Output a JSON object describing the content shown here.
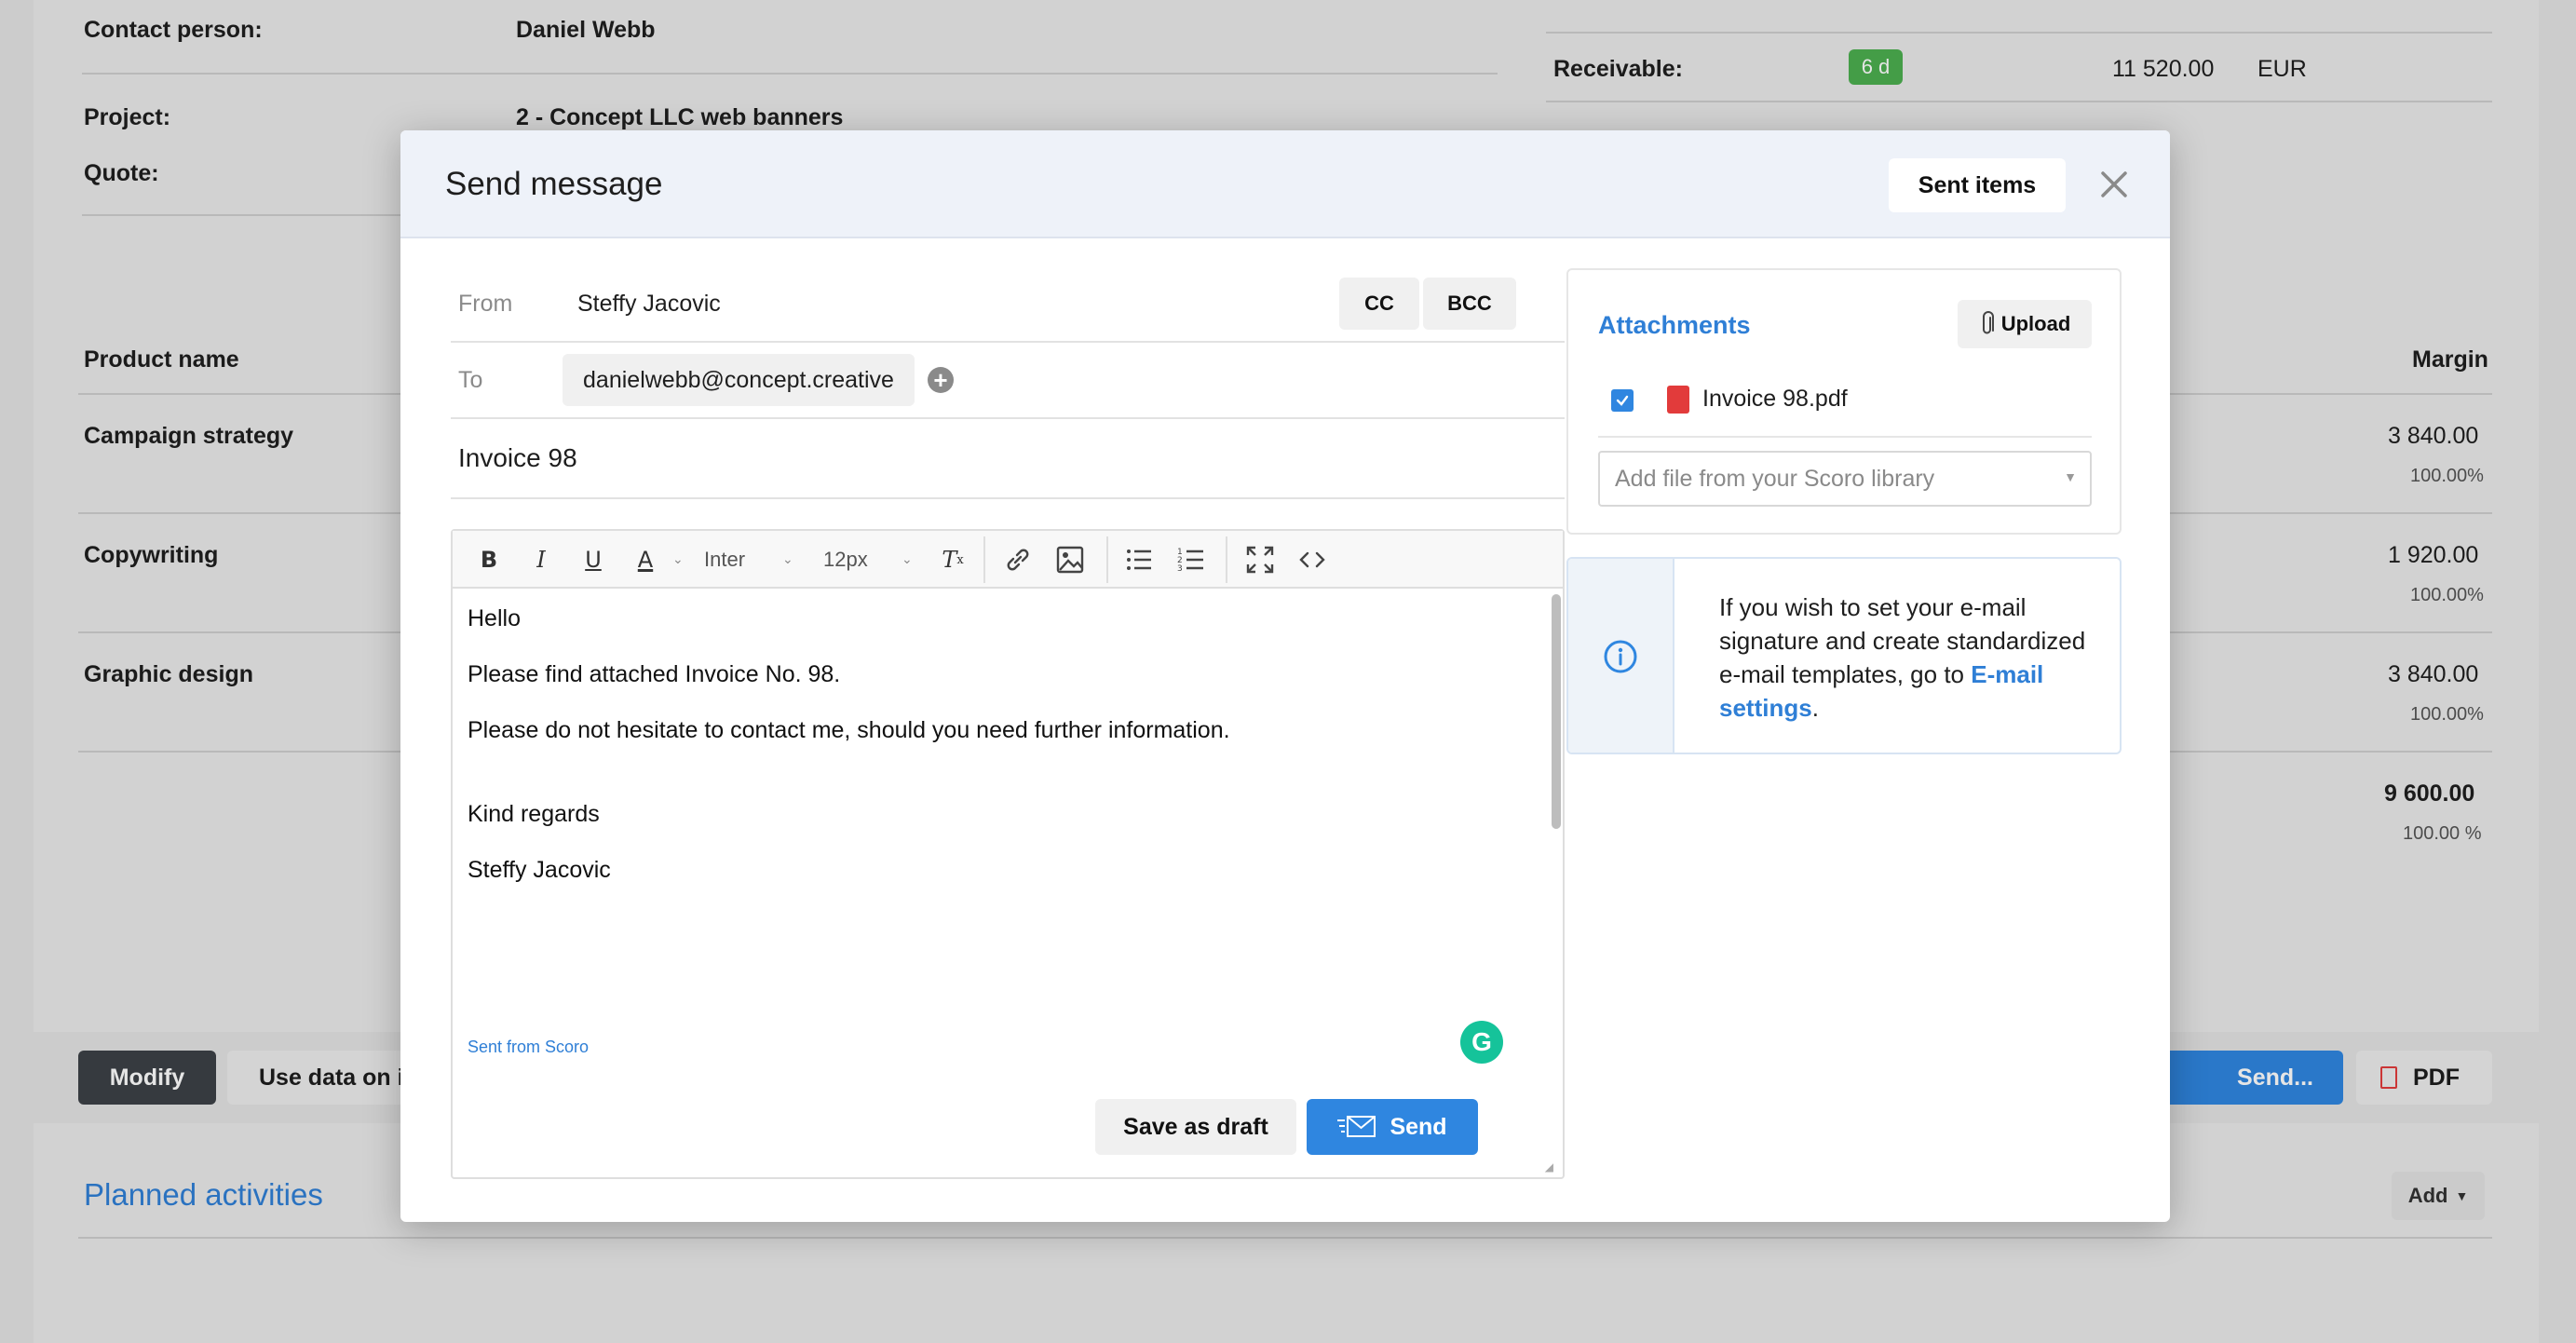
{
  "background": {
    "contact_label": "Contact person:",
    "contact_value": "Daniel Webb",
    "project_label": "Project:",
    "project_value": "2 - Concept LLC web banners",
    "quote_label": "Quote:",
    "receivable_label": "Receivable:",
    "receivable_badge": "6 d",
    "receivable_amount": "11 520.00",
    "receivable_currency": "EUR",
    "product_name_header": "Product name",
    "margin_header": "Margin",
    "products": [
      {
        "name": "Campaign strategy",
        "margin": "3 840.00",
        "pct": "100.00%"
      },
      {
        "name": "Copywriting",
        "margin": "1 920.00",
        "pct": "100.00%"
      },
      {
        "name": "Graphic design",
        "margin": "3 840.00",
        "pct": "100.00%"
      }
    ],
    "total_margin": "9 600.00",
    "total_pct": "100.00 %",
    "modify_button": "Modify",
    "use_data_button": "Use data on i",
    "send_button": "Send...",
    "pdf_button": "PDF",
    "planned_activities": "Planned activities",
    "add_button": "Add"
  },
  "modal": {
    "title": "Send message",
    "sent_items_button": "Sent items",
    "from_label": "From",
    "from_value": "Steffy Jacovic",
    "cc_button": "CC",
    "bcc_button": "BCC",
    "to_label": "To",
    "to_value": "danielwebb@concept.creative",
    "subject": "Invoice 98",
    "toolbar": {
      "font_family": "Inter",
      "font_size": "12px"
    },
    "body": {
      "line1": "Hello",
      "line2": "Please find attached Invoice No. 98.",
      "line3": "Please do not hesitate to contact me, should you need further information.",
      "line4": "Kind regards",
      "line5": "Steffy Jacovic",
      "signature": "Sent from Scoro"
    },
    "save_draft_button": "Save as draft",
    "send_button": "Send",
    "attachments": {
      "title": "Attachments",
      "upload_button": "Upload",
      "file_name": "Invoice 98.pdf",
      "file_checked": true,
      "library_placeholder": "Add file from your Scoro library"
    },
    "info": {
      "text_before": "If you wish to set your e-mail signature and create standardized e-mail templates, go to ",
      "link_text": "E-mail settings",
      "text_after": "."
    }
  },
  "colors": {
    "accent_blue": "#2f86e0",
    "link_blue": "#2f7fd6",
    "badge_green": "#4caf50",
    "dark_button": "#3d4147",
    "pdf_red": "#e23b3b",
    "grammarly_green": "#15c39a"
  }
}
